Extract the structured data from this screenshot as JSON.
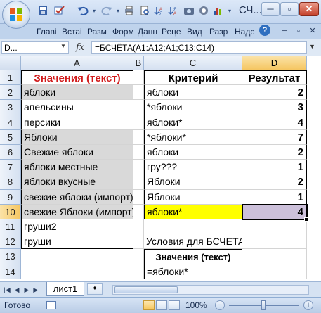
{
  "window": {
    "title": "СЧ...",
    "minimize": "─",
    "restore": "▫",
    "close": "✕"
  },
  "quick_access": {
    "save_icon": "save-icon",
    "undo_icon": "undo-icon",
    "redo_icon": "redo-icon"
  },
  "ribbon": {
    "tabs": [
      "Главі",
      "Встаі",
      "Разм",
      "Форм",
      "Данн",
      "Реце",
      "Вид",
      "Разр",
      "Надс"
    ],
    "help": "?",
    "min": "─",
    "restore": "▫",
    "close": "✕"
  },
  "formula_bar": {
    "name_box": "D...",
    "fx": "fx",
    "formula": "=БСЧЁТА(A1:A12;A1;C13:C14)"
  },
  "columns": [
    "A",
    "B",
    "C",
    "D"
  ],
  "rows": [
    "1",
    "2",
    "3",
    "4",
    "5",
    "6",
    "7",
    "8",
    "9",
    "10",
    "11",
    "12",
    "13",
    "14"
  ],
  "cells": {
    "A": [
      "Значения (текст)",
      "яблоки",
      "апельсины",
      "персики",
      "Яблоки",
      "Свежие яблоки",
      "яблоки местные",
      "яблоки вкусные",
      "свежие яблоки (импорт)",
      "свежие Яблоки (импорт)",
      "груши2",
      "груши",
      "",
      ""
    ],
    "C": [
      "Критерий",
      "яблоки",
      "*яблоки",
      "яблоки*",
      "*яблоки*",
      "яблоки",
      "гру???",
      "Яблоки",
      "Яблоки",
      "яблоки*",
      "",
      "Условия для БСЧЕТА",
      "Значения (текст)",
      "=яблоки*"
    ],
    "D": [
      "Результат",
      "2",
      "3",
      "4",
      "7",
      "2",
      "1",
      "2",
      "1",
      "4",
      "",
      "",
      "",
      ""
    ]
  },
  "sheet_tabs": {
    "active": "лист1"
  },
  "status": {
    "ready": "Готово",
    "zoom": "100%",
    "zoom_minus": "−",
    "zoom_plus": "+"
  },
  "colors": {
    "header_red": "#d11a1a",
    "highlight_yellow": "#ffff00",
    "result_lavender": "#ccc0da",
    "gray_fill": "#d9d9d9"
  }
}
